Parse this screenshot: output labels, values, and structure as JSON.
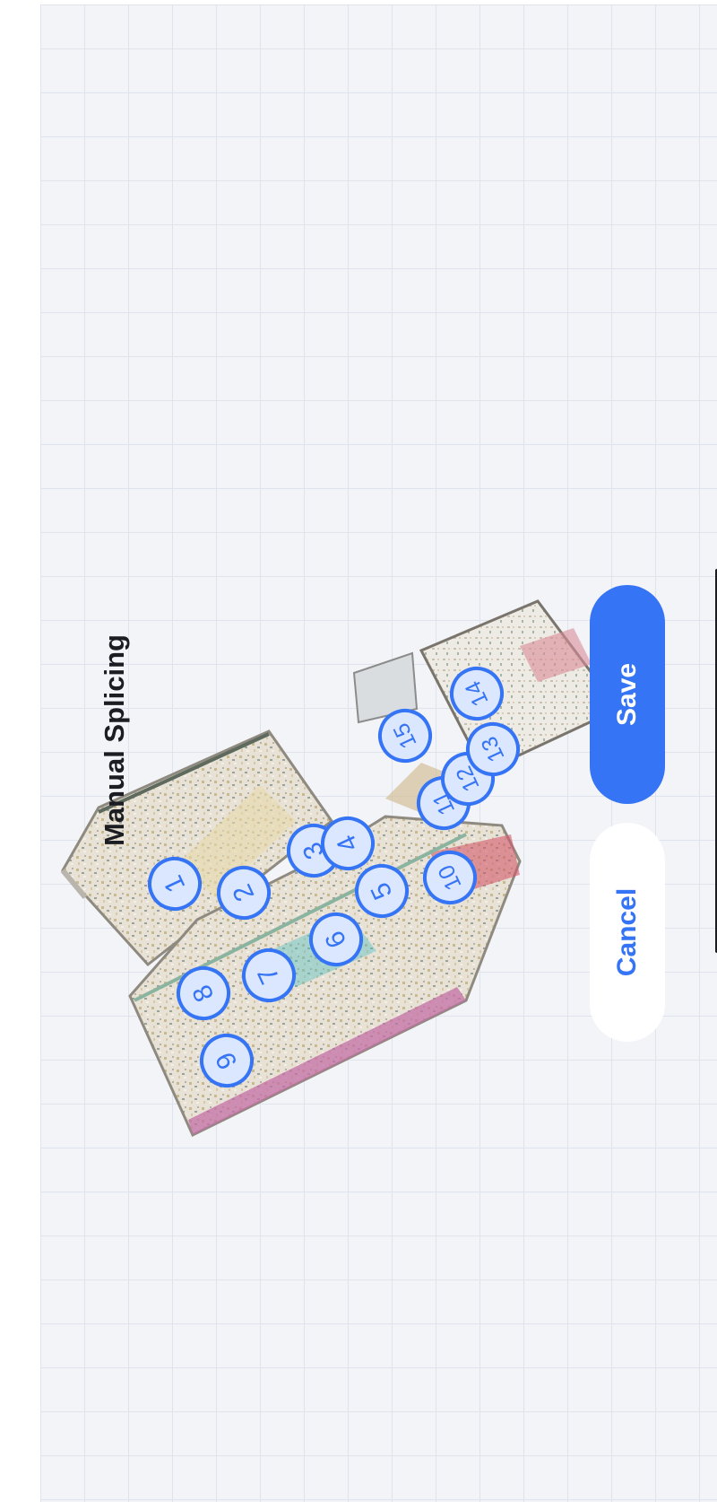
{
  "screen": {
    "title": "Manual Splicing",
    "save_label": "Save",
    "cancel_label": "Cancel"
  },
  "colors": {
    "accent": "#3574f4",
    "marker_fill": "#dbe6ff",
    "grid_background": "#f3f4f8"
  },
  "markers": [
    {
      "label": "1"
    },
    {
      "label": "2"
    },
    {
      "label": "3"
    },
    {
      "label": "4"
    },
    {
      "label": "5"
    },
    {
      "label": "6"
    },
    {
      "label": "7"
    },
    {
      "label": "8"
    },
    {
      "label": "9"
    },
    {
      "label": "10"
    },
    {
      "label": "11"
    },
    {
      "label": "12"
    },
    {
      "label": "13"
    },
    {
      "label": "14"
    },
    {
      "label": "15"
    }
  ]
}
